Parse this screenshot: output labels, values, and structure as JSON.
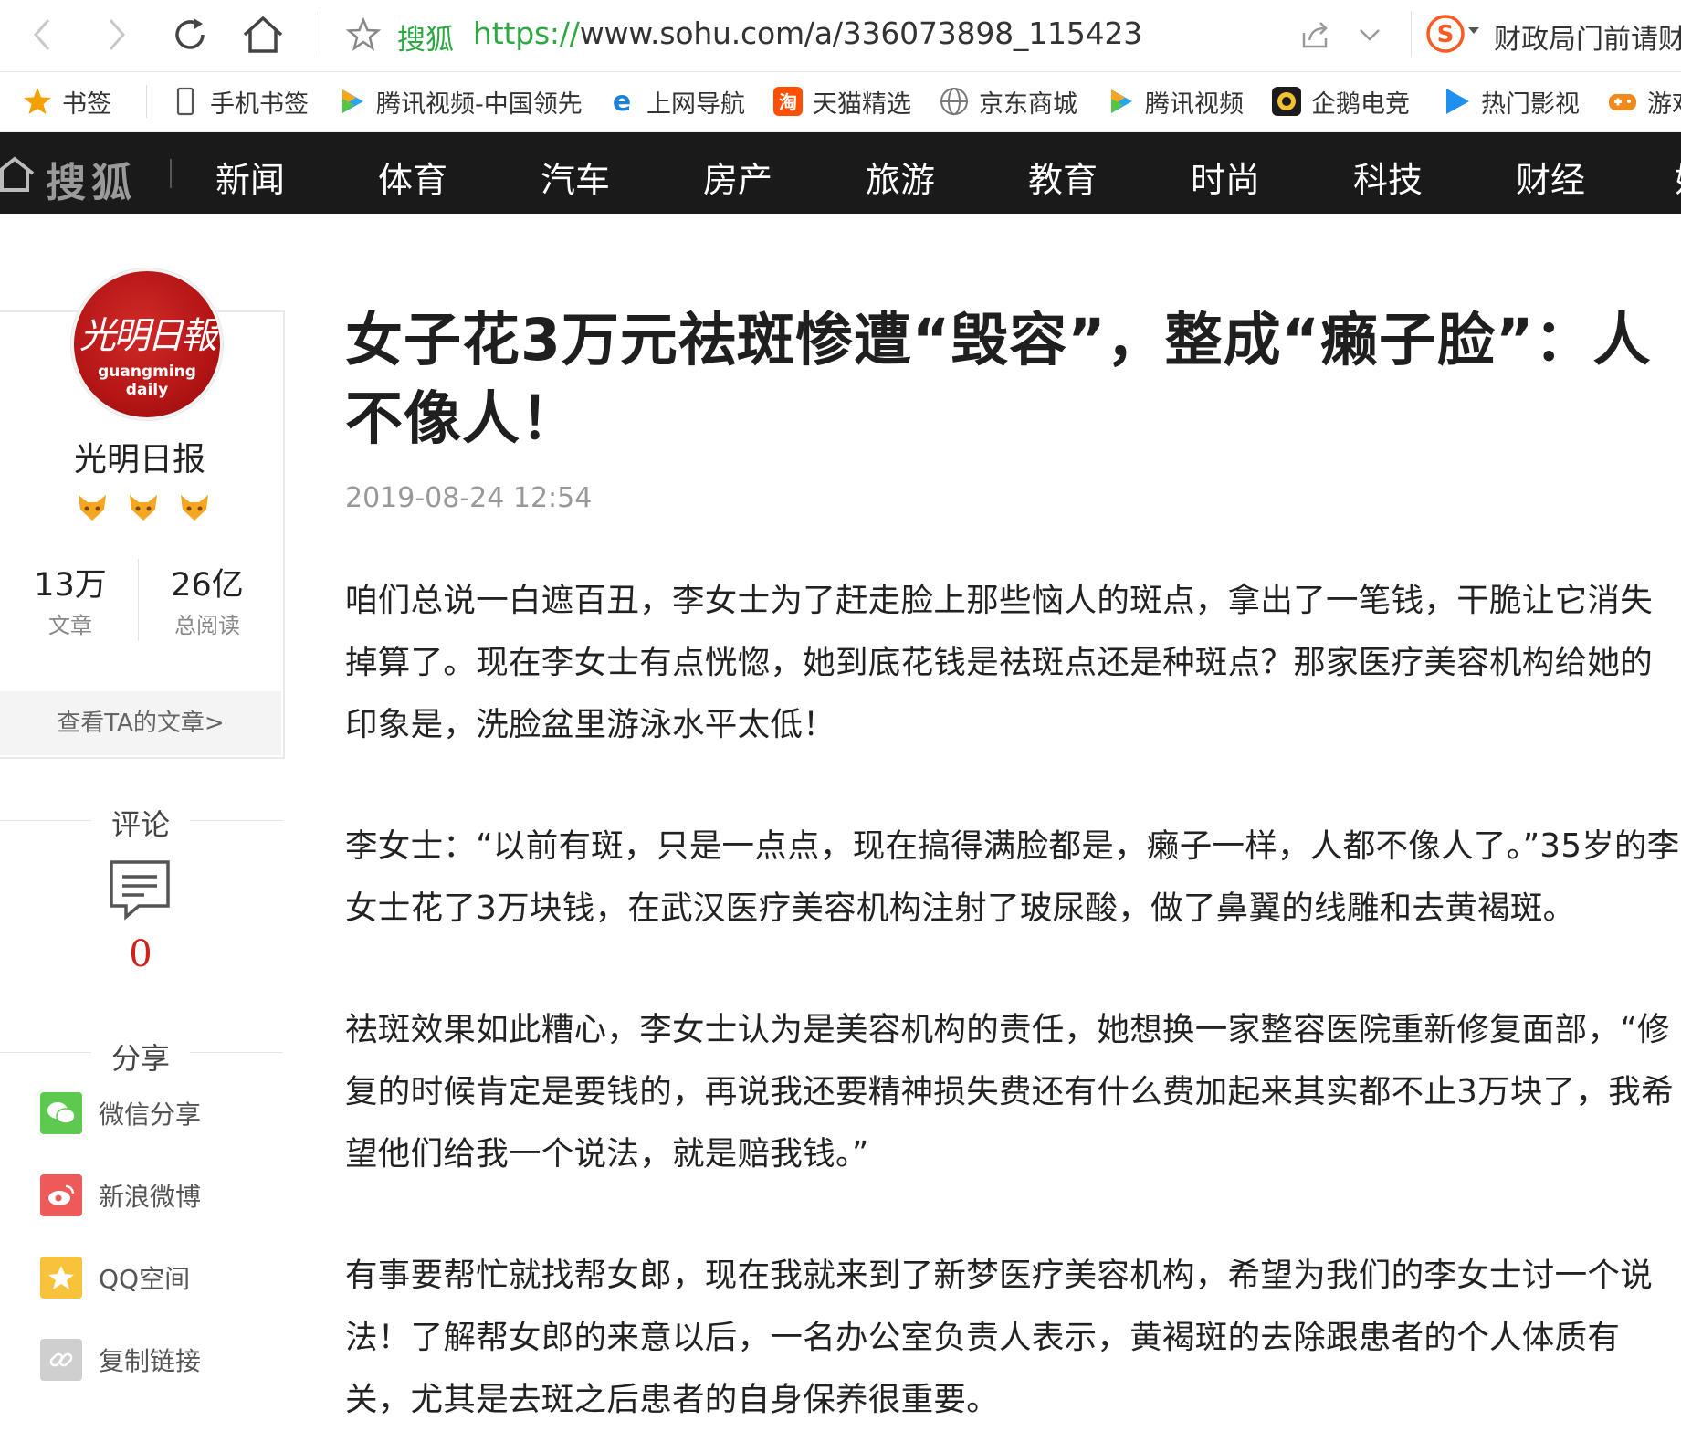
{
  "browser": {
    "site_label": "搜狐",
    "url_protocol": "https://",
    "url_rest": "www.sohu.com/a/336073898_115423",
    "search_suggest": "财政局门前请财"
  },
  "bookmarks": [
    {
      "label": "书签",
      "icon": "star-icon"
    },
    {
      "label": "手机书签",
      "icon": "phone-icon"
    },
    {
      "label": "腾讯视频-中国领先",
      "icon": "tencent-video-icon"
    },
    {
      "label": "上网导航",
      "icon": "ie-icon"
    },
    {
      "label": "天猫精选",
      "icon": "taobao-icon"
    },
    {
      "label": "京东商城",
      "icon": "globe-icon"
    },
    {
      "label": "腾讯视频",
      "icon": "tencent-video-icon"
    },
    {
      "label": "企鹅电竞",
      "icon": "penguin-icon"
    },
    {
      "label": "热门影视",
      "icon": "play-icon"
    },
    {
      "label": "游戏",
      "icon": "gamepad-icon"
    }
  ],
  "sohu": {
    "logo": "搜狐",
    "nav": [
      "新闻",
      "体育",
      "汽车",
      "房产",
      "旅游",
      "教育",
      "时尚",
      "科技",
      "财经",
      "娱"
    ]
  },
  "author": {
    "avatar_script": "光明日報",
    "avatar_en": "guangming daily",
    "name": "光明日报",
    "stats": [
      {
        "num": "13万",
        "label": "文章"
      },
      {
        "num": "26亿",
        "label": "总阅读"
      }
    ],
    "view_articles": "查看TA的文章>"
  },
  "comments": {
    "label": "评论",
    "count": "0"
  },
  "share": {
    "label": "分享",
    "items": [
      {
        "label": "微信分享",
        "icon": "wechat-icon",
        "color": "#5ec94f"
      },
      {
        "label": "新浪微博",
        "icon": "weibo-icon",
        "color": "#ee5a5a"
      },
      {
        "label": "QQ空间",
        "icon": "qzone-icon",
        "color": "#f8c33a"
      },
      {
        "label": "复制链接",
        "icon": "link-icon",
        "color": "#cfcfcf"
      }
    ]
  },
  "article": {
    "title": "女子花3万元祛斑惨遭“毁容”，整成“癞子脸”：人不像人！",
    "time": "2019-08-24 12:54",
    "paragraphs": [
      "咱们总说一白遮百丑，李女士为了赶走脸上那些恼人的斑点，拿出了一笔钱，干脆让它消失掉算了。现在李女士有点恍惚，她到底花钱是祛斑点还是种斑点？那家医疗美容机构给她的印象是，洗脸盆里游泳水平太低！",
      "李女士：“以前有斑，只是一点点，现在搞得满脸都是，癞子一样，人都不像人了。”35岁的李女士花了3万块钱，在武汉医疗美容机构注射了玻尿酸，做了鼻翼的线雕和去黄褐斑。",
      "祛斑效果如此糟心，李女士认为是美容机构的责任，她想换一家整容医院重新修复面部，“修复的时候肯定是要钱的，再说我还要精神损失费还有什么费加起来其实都不止3万块了，我希望他们给我一个说法，就是赔我钱。”",
      "有事要帮忙就找帮女郎，现在我就来到了新梦医疗美容机构，希望为我们的李女士讨一个说法！了解帮女郎的来意以后，一名办公室负责人表示，黄褐斑的去除跟患者的个人体质有关，尤其是去斑之后患者的自身保养很重要。"
    ]
  }
}
